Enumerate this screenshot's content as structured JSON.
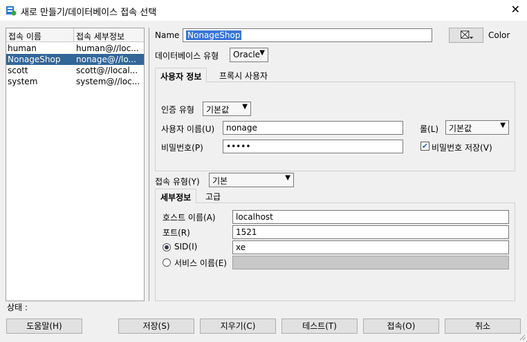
{
  "window": {
    "title": "새로 만들기/데이터베이스 접속 선택",
    "close_glyph": "✕"
  },
  "connections": {
    "headers": [
      "접속 이름",
      "접속 세부정보"
    ],
    "rows": [
      {
        "name": "human",
        "detail": "human@//loc..."
      },
      {
        "name": "NonageShop",
        "detail": "nonage@//lo..."
      },
      {
        "name": "scott",
        "detail": "scott@//local..."
      },
      {
        "name": "system",
        "detail": "system@//loc..."
      }
    ],
    "selected_index": 1
  },
  "form": {
    "name_label": "Name",
    "name_value": "NonageShop",
    "color_label": "Color",
    "dbtype_label": "데이터베이스 유형",
    "dbtype_value": "Oracle"
  },
  "auth_tabs": [
    "사용자 정보",
    "프록시 사용자"
  ],
  "auth": {
    "auth_type_label": "인증 유형",
    "auth_type_value": "기본값",
    "username_label": "사용자 이름(U)",
    "username_value": "nonage",
    "role_label": "롤(L)",
    "role_value": "기본값",
    "password_label": "비밀번호(P)",
    "password_value": "•••••",
    "save_password_label": "비밀번호 저장(V)",
    "save_password_checked": true
  },
  "conn": {
    "type_label": "접속 유형(Y)",
    "type_value": "기본"
  },
  "detail_tabs": [
    "세부정보",
    "고급"
  ],
  "detail": {
    "host_label": "호스트 이름(A)",
    "host_value": "localhost",
    "port_label": "포트(R)",
    "port_value": "1521",
    "sid_label": "SID(I)",
    "sid_value": "xe",
    "service_label": "서비스 이름(E)",
    "service_value": ""
  },
  "status": {
    "label": "상태 :"
  },
  "buttons": {
    "help": "도움말(H)",
    "save": "저장(S)",
    "clear": "지우기(C)",
    "test": "테스트(T)",
    "connect": "접속(O)",
    "cancel": "취소"
  },
  "colors": {
    "selection": "#336699",
    "name_highlight": "#3875d7"
  }
}
